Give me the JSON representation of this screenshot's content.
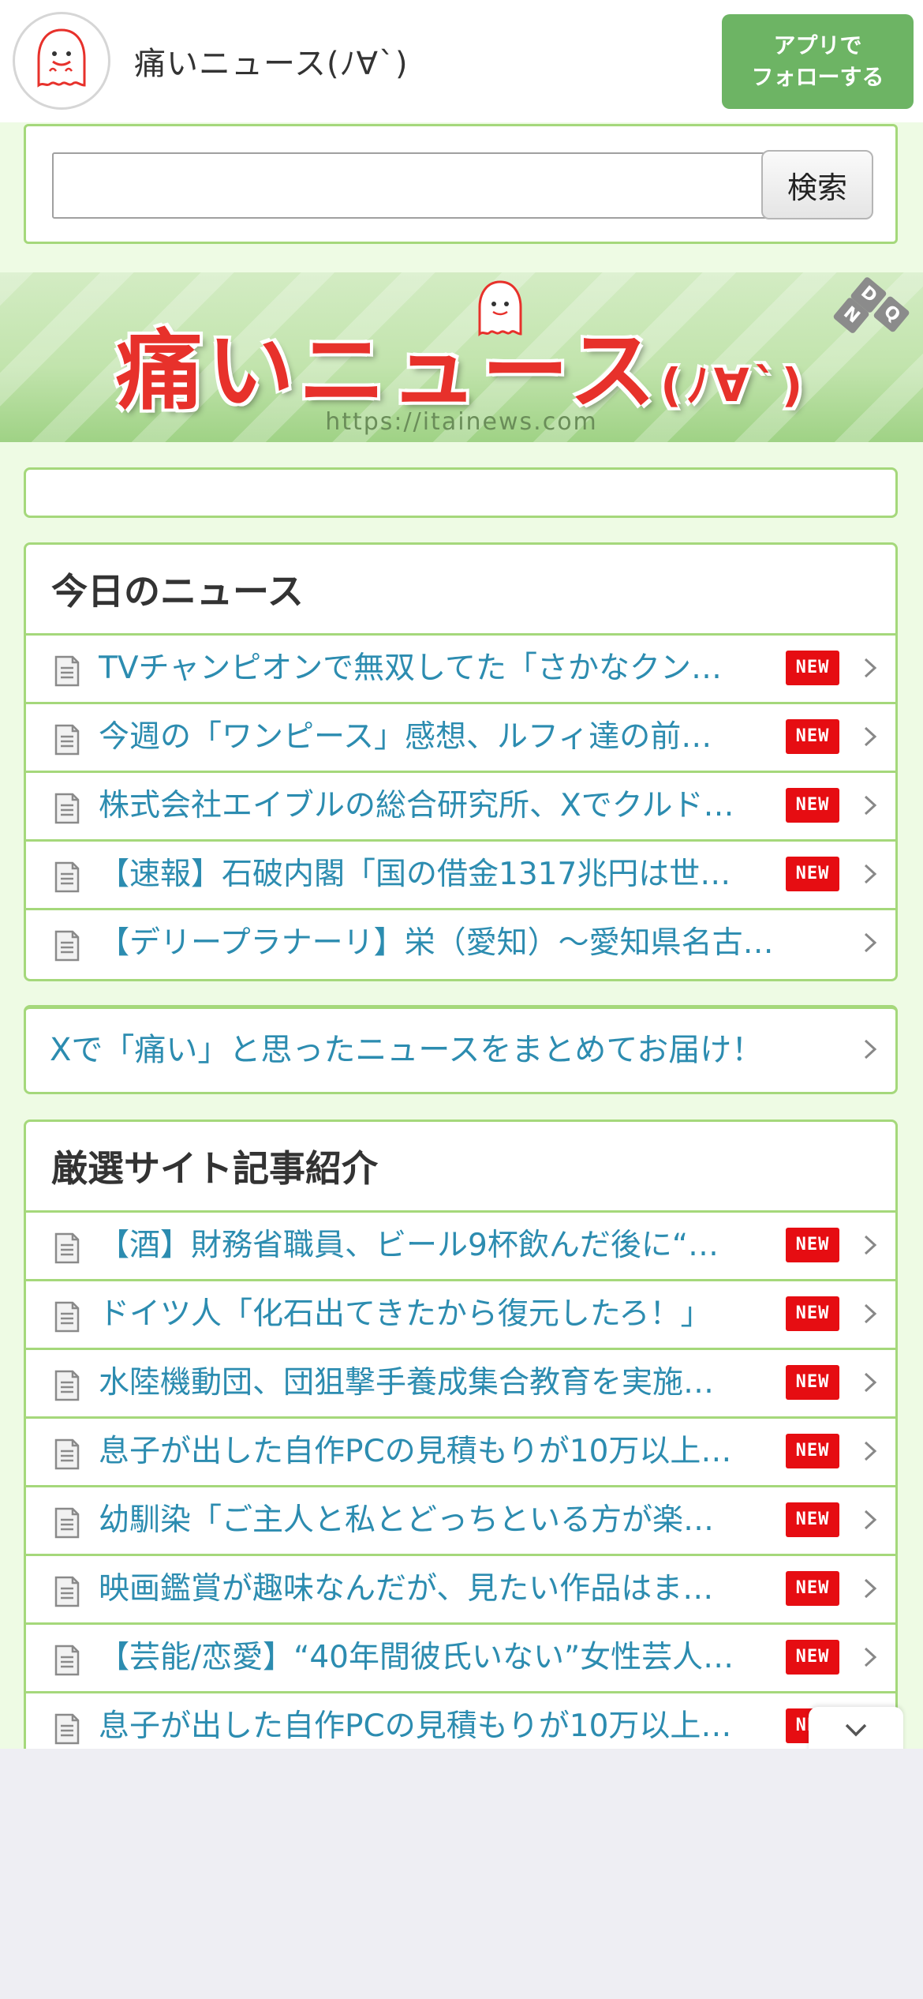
{
  "header": {
    "site_title": "痛いニュース(ﾉ∀`)",
    "follow_line1": "アプリで",
    "follow_line2": "フォローする"
  },
  "search": {
    "value": "",
    "button_label": "検索"
  },
  "banner": {
    "title": "痛いニュース",
    "face": "(ﾉ∀`)",
    "url": "https://itainews.com",
    "badge": [
      "D",
      "Q",
      "N"
    ]
  },
  "today_news": {
    "heading": "今日のニュース",
    "new_label": "NEW",
    "items": [
      {
        "title": "TVチャンピオンで無双してた「さかなクン…",
        "new": true
      },
      {
        "title": "今週の「ワンピース」感想、ルフィ達の前…",
        "new": true
      },
      {
        "title": "株式会社エイブルの総合研究所、Xでクルド…",
        "new": true
      },
      {
        "title": "【速報】石破内閣「国の借金1317兆円は世…",
        "new": true
      },
      {
        "title": "【デリープラナーリ】栄（愛知）〜愛知県名古…",
        "new": false
      }
    ]
  },
  "promo": {
    "text": "Xで「痛い」と思ったニュースをまとめてお届け！"
  },
  "featured": {
    "heading": "厳選サイト記事紹介",
    "new_label": "NEW",
    "items": [
      {
        "title": "【酒】財務省職員、ビール9杯飲んだ後に“…",
        "new": true
      },
      {
        "title": "ドイツ人「化石出てきたから復元したろ！」",
        "new": true
      },
      {
        "title": "水陸機動団、団狙撃手養成集合教育を実施…",
        "new": true
      },
      {
        "title": "息子が出した自作PCの見積もりが10万以上…",
        "new": true
      },
      {
        "title": "幼馴染「ご主人と私とどっちといる方が楽…",
        "new": true
      },
      {
        "title": "映画鑑賞が趣味なんだが、見たい作品はま…",
        "new": true
      },
      {
        "title": "【芸能/恋愛】“40年間彼氏いない”女性芸人…",
        "new": true
      },
      {
        "title": "息子が出した自作PCの見積もりが10万以上…",
        "new": true
      }
    ]
  },
  "colors": {
    "accent_green": "#a5d87b",
    "follow_button": "#6db464",
    "link_blue": "#2c8cb0",
    "new_badge": "#e60d12"
  }
}
